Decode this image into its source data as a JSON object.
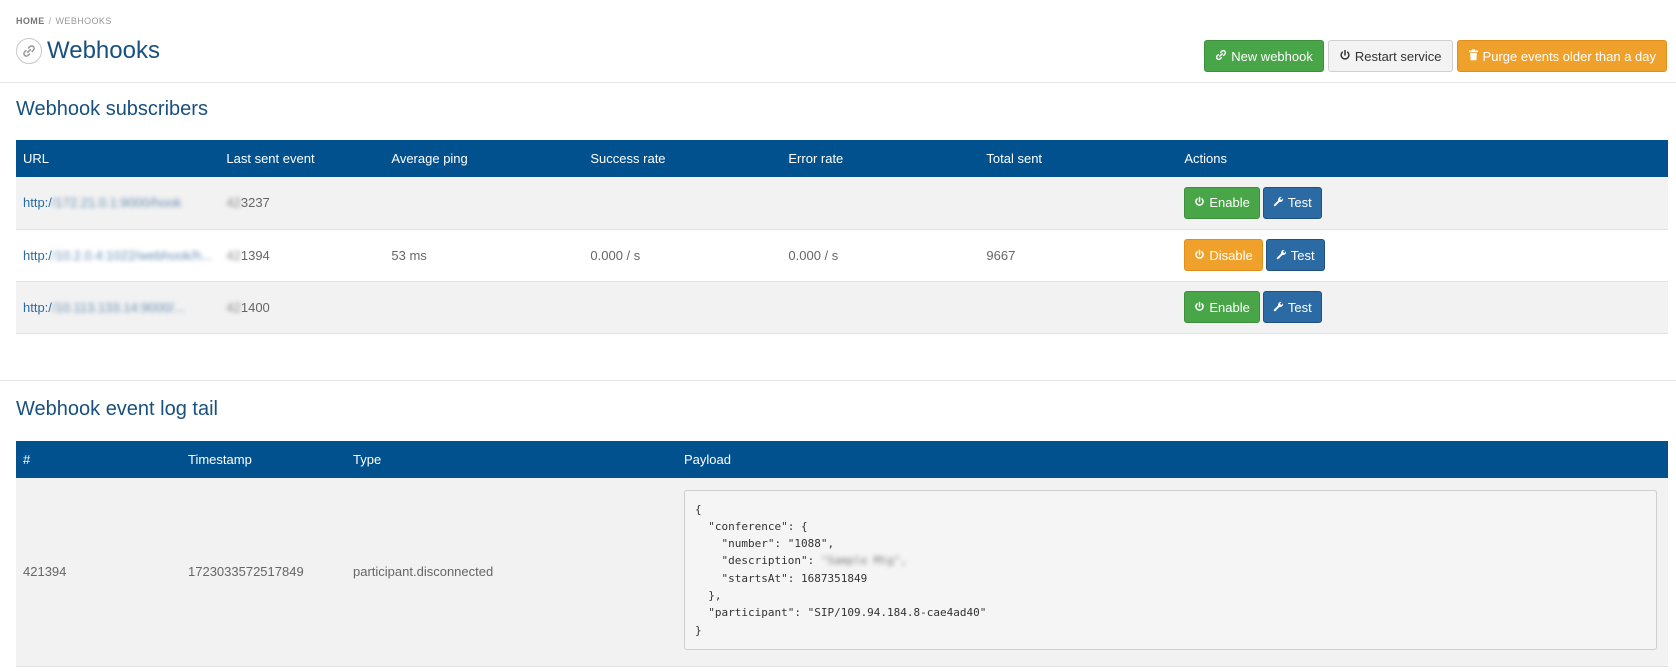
{
  "breadcrumb": {
    "home": "HOME",
    "separator": "/",
    "current": "WEBHOOKS"
  },
  "header": {
    "title": "Webhooks",
    "icon": "link-icon"
  },
  "toolbar": {
    "new_webhook": "New webhook",
    "restart_service": "Restart service",
    "purge_events": "Purge events older than a day"
  },
  "subscribers": {
    "section_title": "Webhook subscribers",
    "columns": [
      "URL",
      "Last sent event",
      "Average ping",
      "Success rate",
      "Error rate",
      "Total sent",
      "Actions"
    ],
    "rows": [
      {
        "url_prefix": "http:/",
        "url_hidden": "/172.21.0.1:9000/hook",
        "last_hidden": "42",
        "last_sent": "3237",
        "ping": "",
        "success": "",
        "error": "",
        "total": "",
        "toggle": "Enable",
        "toggle_state": "enable",
        "test": "Test"
      },
      {
        "url_prefix": "http:/",
        "url_hidden": "/10.2.0.4:1022/webhook/h...",
        "last_hidden": "42",
        "last_sent": "1394",
        "ping": "53 ms",
        "success": "0.000 / s",
        "error": "0.000 / s",
        "total": "9667",
        "toggle": "Disable",
        "toggle_state": "disable",
        "test": "Test"
      },
      {
        "url_prefix": "http:/",
        "url_hidden": "/10.113.133.14:9000/...",
        "last_hidden": "42",
        "last_sent": "1400",
        "ping": "",
        "success": "",
        "error": "",
        "total": "",
        "toggle": "Enable",
        "toggle_state": "enable",
        "test": "Test"
      }
    ]
  },
  "event_log": {
    "section_title": "Webhook event log tail",
    "columns": [
      "#",
      "Timestamp",
      "Type",
      "Payload"
    ],
    "rows": [
      {
        "id": "421394",
        "timestamp": "1723033572517849",
        "type": "participant.disconnected",
        "payload_lines": [
          "{",
          "  \"conference\": {",
          "    \"number\": \"1088\",",
          "    \"description\": ",
          "    \"startsAt\": 1687351849",
          "  },",
          "  \"participant\": \"SIP/109.94.184.8-cae4ad40\"",
          "}"
        ],
        "description_hidden": "\"Sample Mtg\","
      }
    ]
  },
  "colors": {
    "header_blue": "#02518f",
    "title_blue": "#18507f",
    "green": "#48a548",
    "orange": "#f0a12b",
    "button_blue": "#2b6aa3"
  }
}
